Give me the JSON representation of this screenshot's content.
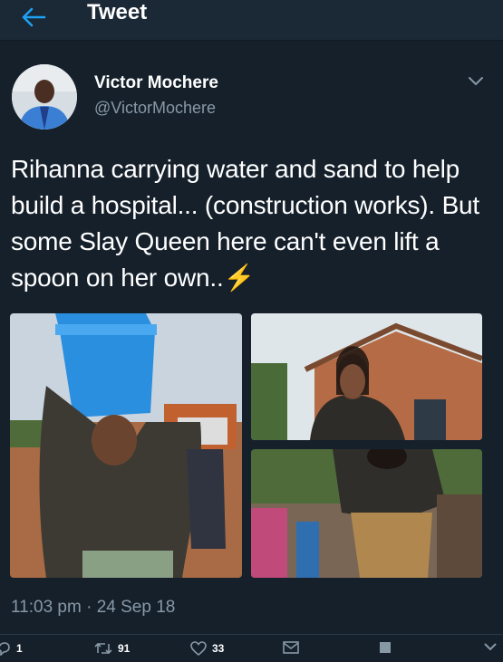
{
  "header": {
    "title": "Tweet",
    "back_icon": "arrow-left-icon",
    "accent": "#1da1f2"
  },
  "author": {
    "display_name": "Victor Mochere",
    "handle": "@VictorMochere"
  },
  "tweet": {
    "text": "Rihanna carrying water and sand to help build a hospital... (construction works). But some Slay Queen here can't even lift a spoon on her own..",
    "emoji": "⚡",
    "timestamp": "11:03 pm · 24 Sep 18"
  },
  "actions": {
    "reply_count": "1",
    "retweet_count": "91",
    "like_count": "33"
  },
  "colors": {
    "background": "#15202b",
    "secondary_text": "#8899a6"
  }
}
